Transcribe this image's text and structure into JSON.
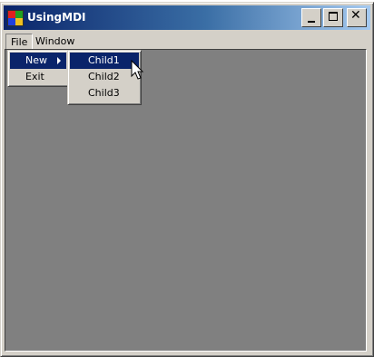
{
  "window": {
    "title": "UsingMDI",
    "icon": "mdi-app-icon",
    "caption_buttons": [
      "minimize-icon",
      "maximize-icon",
      "close-icon"
    ]
  },
  "menubar": {
    "items": [
      {
        "label": "File"
      },
      {
        "label": "Window"
      }
    ]
  },
  "file_menu": {
    "items": [
      {
        "label": "New",
        "has_submenu": true,
        "highlighted": true
      },
      {
        "label": "Exit"
      }
    ]
  },
  "new_submenu": {
    "items": [
      {
        "label": "Child1",
        "highlighted": true
      },
      {
        "label": "Child2"
      },
      {
        "label": "Child3"
      }
    ]
  },
  "colors": {
    "titlebar_start": "#0a246a",
    "titlebar_end": "#a6caf0",
    "menu_highlight": "#0a246a",
    "mdi_background": "#808080",
    "face": "#d4d0c8"
  }
}
